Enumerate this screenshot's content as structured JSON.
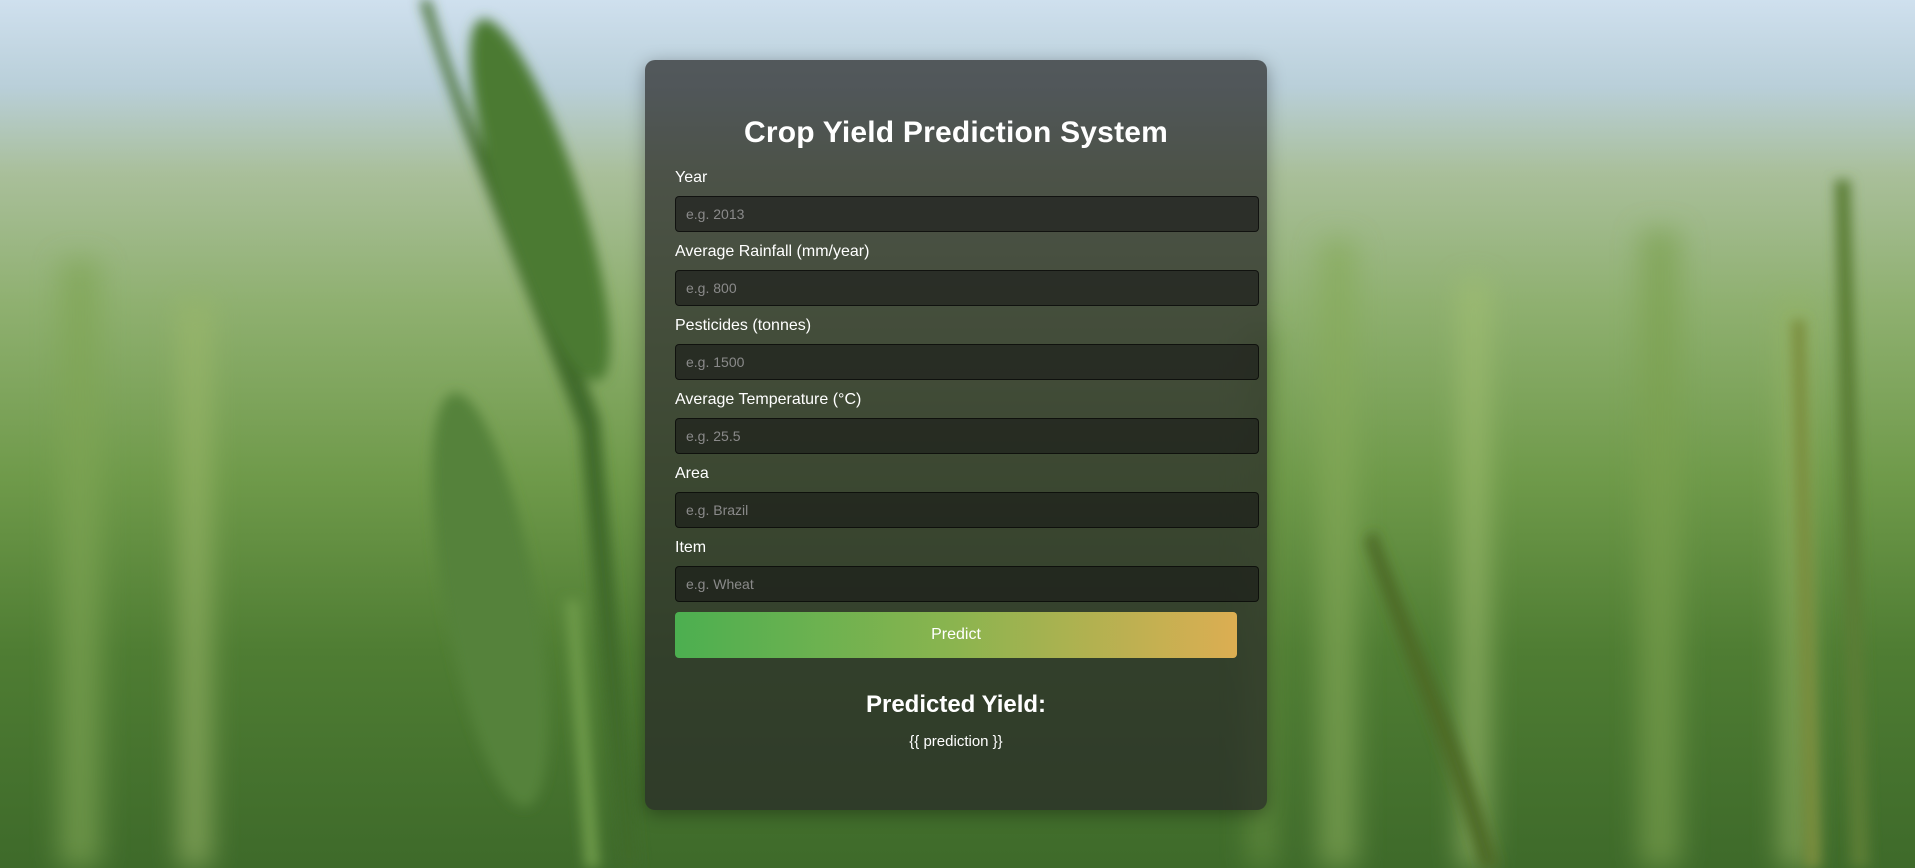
{
  "page": {
    "title": "Crop Yield Prediction System"
  },
  "form": {
    "fields": [
      {
        "label": "Year",
        "placeholder": "e.g. 2013"
      },
      {
        "label": "Average Rainfall (mm/year)",
        "placeholder": "e.g. 800"
      },
      {
        "label": "Pesticides (tonnes)",
        "placeholder": "e.g. 1500"
      },
      {
        "label": "Average Temperature (°C)",
        "placeholder": "e.g. 25.5"
      },
      {
        "label": "Area",
        "placeholder": "e.g. Brazil"
      },
      {
        "label": "Item",
        "placeholder": "e.g. Wheat"
      }
    ],
    "submit_label": "Predict"
  },
  "result": {
    "title": "Predicted Yield:",
    "value": "{{ prediction }}"
  },
  "colors": {
    "button_start": "#4caf50",
    "button_end": "#dcae52",
    "card_bg": "rgba(40,40,40,0.72)"
  }
}
